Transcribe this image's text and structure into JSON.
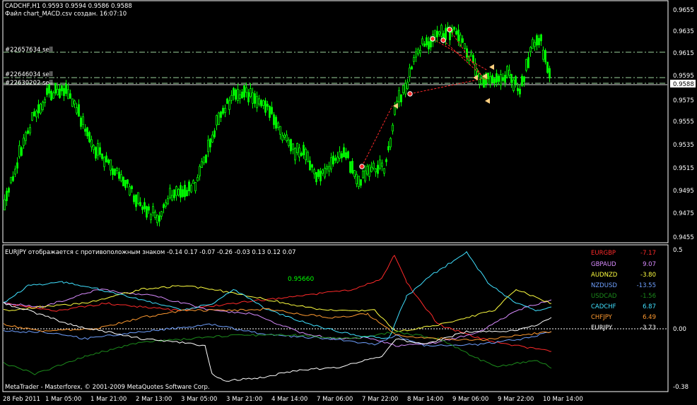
{
  "main_chart": {
    "header": "CADCHF,H1  0.9593 0.9594 0.9586 0.9588",
    "subheader": "Файл chart_MACD.csv создан. 16:07:10",
    "y_labels": [
      "0.9655",
      "0.9635",
      "0.9615",
      "0.9595",
      "0.9575",
      "0.9555",
      "0.9535",
      "0.9515",
      "0.9495",
      "0.9475",
      "0.9455"
    ],
    "current_price": "0.9588",
    "order_labels": [
      "#22657634 sell",
      "#22646034 sell",
      "#22630202 sell"
    ],
    "colors": {
      "candle": "#00ff00",
      "order_line": "#ffffff",
      "trade_line": "#ff0000"
    }
  },
  "indicator": {
    "header": "EURJPY отображается с противоположным знаком  -0.14 0.17 -0.07 -0.26 -0.03 0.13 0.12 0.07",
    "annotation": "0.95660",
    "y_labels": [
      "0.5",
      "0.00",
      "-0.38"
    ],
    "legend": [
      {
        "symbol": "EURGBP",
        "value": "-7.17",
        "color": "#ff2a2a"
      },
      {
        "symbol": "GBPAUD",
        "value": "9.07",
        "color": "#d98cff"
      },
      {
        "symbol": "AUDNZD",
        "value": "-3.80",
        "color": "#ffff40"
      },
      {
        "symbol": "NZDUSD",
        "value": "-13.55",
        "color": "#6fa0ff"
      },
      {
        "symbol": "USDCAD",
        "value": "-1.56",
        "color": "#1c8c1c"
      },
      {
        "symbol": "CADCHF",
        "value": "6.87",
        "color": "#40e0ff"
      },
      {
        "symbol": "CHFJPY",
        "value": "6.49",
        "color": "#ff9a30"
      },
      {
        "symbol": "EURJPY",
        "value": "-3.73",
        "color": "#ffffff"
      }
    ],
    "copyright": "MetaTrader - Masterforex, © 2001-2009 MetaQuotes Software Corp."
  },
  "time_axis": [
    "28 Feb 2011",
    "1 Mar 05:00",
    "1 Mar 21:00",
    "2 Mar 13:00",
    "3 Mar 05:00",
    "3 Mar 21:00",
    "4 Mar 14:00",
    "7 Mar 06:00",
    "7 Mar 22:00",
    "8 Mar 14:00",
    "9 Mar 06:00",
    "9 Mar 22:00",
    "10 Mar 14:00"
  ]
}
